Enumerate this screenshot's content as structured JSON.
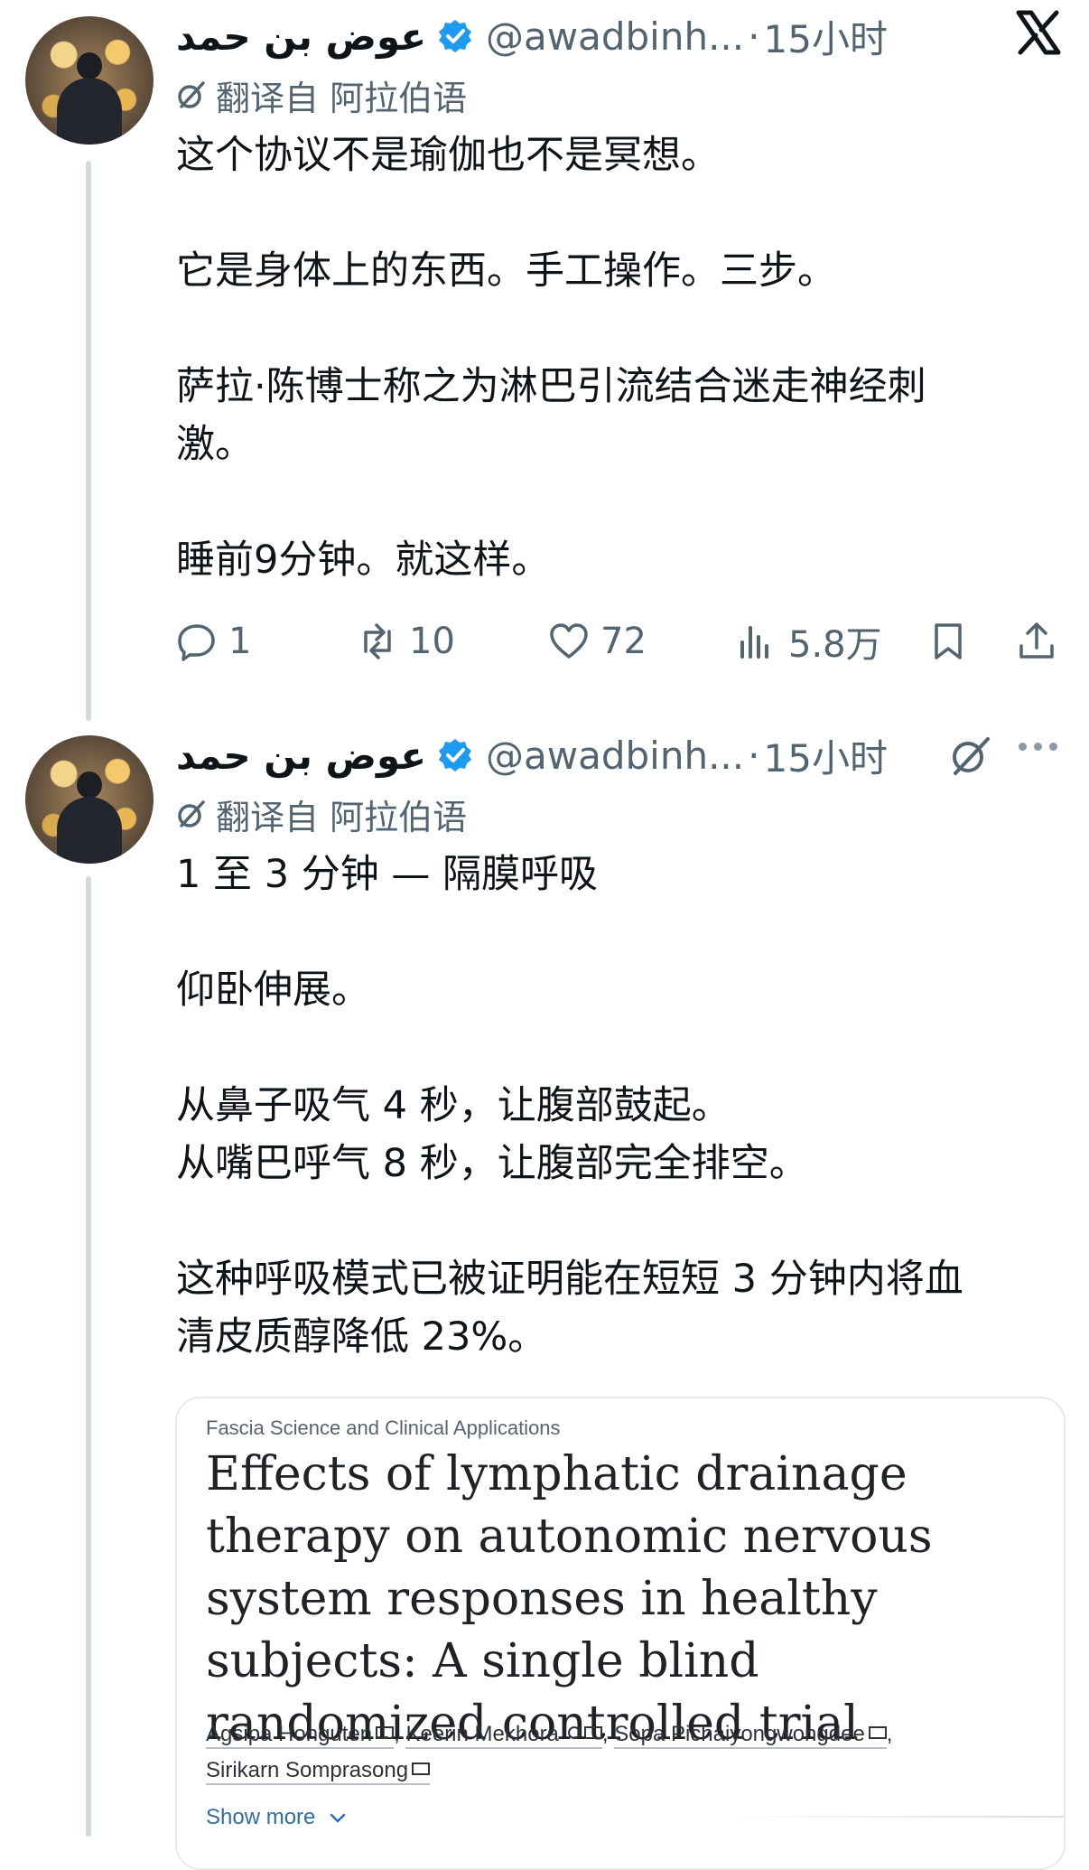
{
  "colors": {
    "verified": "#1d9bf0",
    "secondary_text": "#536471",
    "thread_line": "#cfd9de"
  },
  "tweet1": {
    "author_name": "عوض بن حمد",
    "handle": "@awadbinh...",
    "separator": "·",
    "time": "15小时",
    "translated_label": "翻译自 阿拉伯语",
    "paragraphs": [
      "这个协议不是瑜伽也不是冥想。",
      "它是身体上的东西。手工操作。三步。",
      "萨拉·陈博士称之为淋巴引流结合迷走神经刺\n激。",
      "睡前9分钟。就这样。"
    ],
    "actions": {
      "replies": "1",
      "reposts": "10",
      "likes": "72",
      "views": "5.8万"
    }
  },
  "tweet2": {
    "author_name": "عوض بن حمد",
    "handle": "@awadbinh...",
    "separator": "·",
    "time": "15小时",
    "translated_label": "翻译自 阿拉伯语",
    "paragraphs": [
      "1 至 3 分钟 — 隔膜呼吸",
      "仰卧伸展。",
      "从鼻子吸气 4 秒，让腹部鼓起。\n从嘴巴呼气 8 秒，让腹部完全排空。",
      "这种呼吸模式已被证明能在短短 3 分钟内将血\n清皮质醇降低 23%。"
    ]
  },
  "card": {
    "journal": "Fascia Science and Clinical Applications",
    "title": "Effects of lymphatic drainage therapy on autonomic nervous system responses in healthy subjects: A single blind randomized controlled trial",
    "authors": [
      "Agsipa Honguten",
      "Keerin Mekhora",
      "Sopa Pichaiyongwongdee",
      "Sirikarn Somprasong"
    ],
    "show_more": "Show more"
  },
  "icons": [
    "x-logo-icon",
    "verified-badge-icon",
    "grok-translate-icon",
    "more-options-icon",
    "reply-icon",
    "repost-icon",
    "like-icon",
    "views-icon",
    "bookmark-icon",
    "share-icon",
    "mail-icon",
    "person-icon",
    "chevron-down-icon"
  ]
}
